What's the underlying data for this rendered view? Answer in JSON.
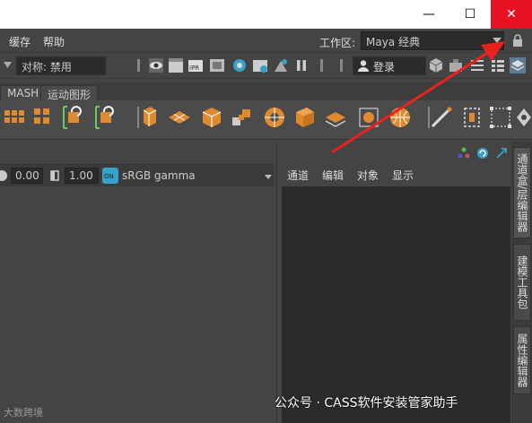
{
  "window": {
    "min_symbol": "—",
    "max_symbol": "☐",
    "close_symbol": "✕"
  },
  "menu": {
    "items": [
      "缓存",
      "帮助"
    ]
  },
  "workspace": {
    "label": "工作区:",
    "value": "Maya 经典"
  },
  "status": {
    "symmetry": "对称: 禁用",
    "login": "登录"
  },
  "shelf": {
    "tabs": [
      "MASH",
      "运动图形"
    ]
  },
  "viewport": {
    "exposure": "0.00",
    "gamma_val": "1.00",
    "color_space": "sRGB gamma",
    "logo": "大数跨境"
  },
  "channel_box": {
    "menu": [
      "通道",
      "编辑",
      "对象",
      "显示"
    ]
  },
  "side_tabs": [
    "通道盒/层编辑器",
    "建模工具包",
    "属性编辑器"
  ],
  "watermark": "公众号 · CASS软件安装管家助手",
  "colors": {
    "close_red": "#e81123",
    "annotation": "#e8221c",
    "ui_bg": "#444444"
  }
}
